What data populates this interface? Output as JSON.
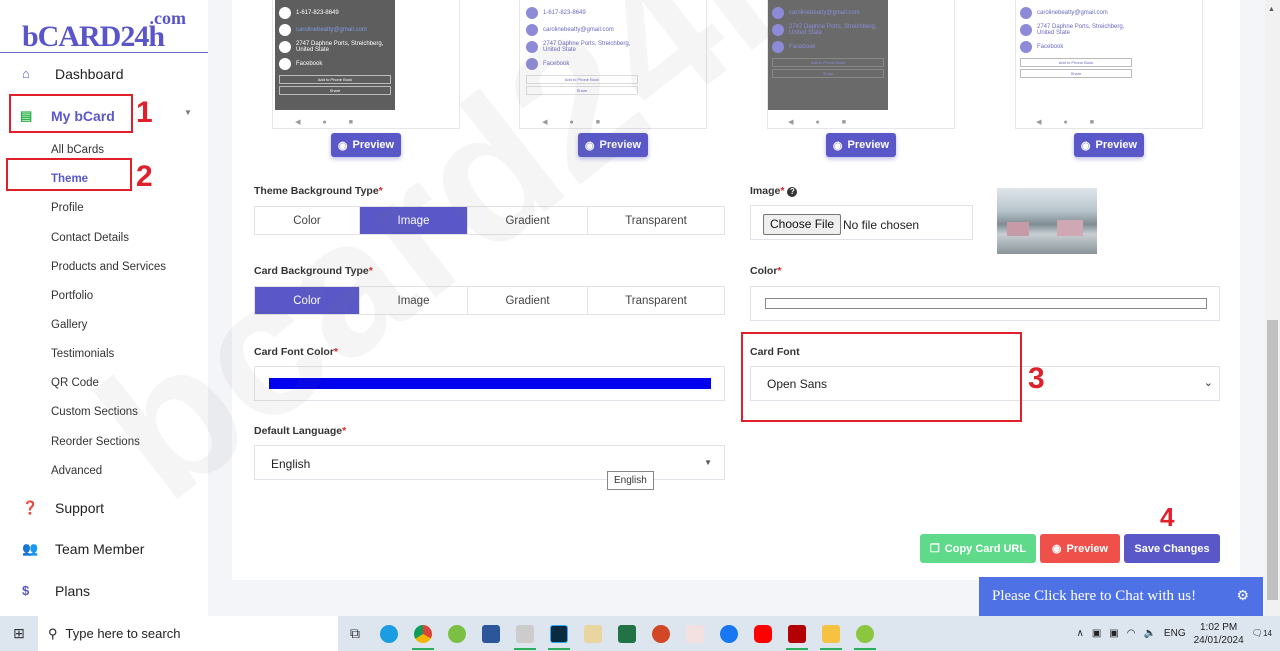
{
  "logo": {
    "com": ".com",
    "main": "bCARD24h"
  },
  "sidebar": {
    "items": [
      {
        "label": "Dashboard",
        "icon": "home-icon"
      },
      {
        "label": "My bCard",
        "icon": "card-icon"
      },
      {
        "label": "Support",
        "icon": "question-icon"
      },
      {
        "label": "Team Member",
        "icon": "users-icon"
      },
      {
        "label": "Plans",
        "icon": "dollar-icon"
      }
    ],
    "subitems": [
      "All bCards",
      "Theme",
      "Profile",
      "Contact Details",
      "Products and Services",
      "Portfolio",
      "Gallery",
      "Testimonials",
      "QR Code",
      "Custom Sections",
      "Reorder Sections",
      "Advanced"
    ]
  },
  "annotations": [
    "1",
    "2",
    "3",
    "4"
  ],
  "card_previews": {
    "phone": "1-617-823-8649",
    "email": "carolinebeatty@gmail.com",
    "address": "2747 Daphne Ports, Streichberg, United State",
    "social": "Facebook",
    "add_btn": "Add to Phone Book",
    "share_btn": "Share",
    "preview_label": "Preview"
  },
  "form": {
    "theme_bg": {
      "label": "Theme Background Type",
      "req": "*",
      "options": [
        "Color",
        "Image",
        "Gradient",
        "Transparent"
      ],
      "selected": "Image"
    },
    "image": {
      "label": "Image",
      "req": "*",
      "choose": "Choose File",
      "status": "No file chosen"
    },
    "card_bg": {
      "label": "Card Background Type",
      "req": "*",
      "options": [
        "Color",
        "Image",
        "Gradient",
        "Transparent"
      ],
      "selected": "Color"
    },
    "color": {
      "label": "Color",
      "req": "*"
    },
    "font_color": {
      "label": "Card Font Color",
      "req": "*",
      "value": "#0000ee"
    },
    "card_font": {
      "label": "Card Font",
      "value": "Open Sans"
    },
    "language": {
      "label": "Default Language",
      "req": "*",
      "value": "English",
      "tooltip": "English"
    }
  },
  "actions": {
    "copy": "Copy Card URL",
    "preview": "Preview",
    "save": "Save Changes"
  },
  "chat": {
    "text": "Please Click here to Chat with us!"
  },
  "watermark": "bcard24h.com",
  "taskbar": {
    "search": "Type here to search",
    "lang": "ENG",
    "time": "1:02 PM",
    "date": "24/01/2024",
    "notif": "14"
  },
  "colors": {
    "accent": "#5a58c9",
    "copy": "#5fd98a",
    "preview": "#f0504a",
    "red": "#e0202a"
  }
}
